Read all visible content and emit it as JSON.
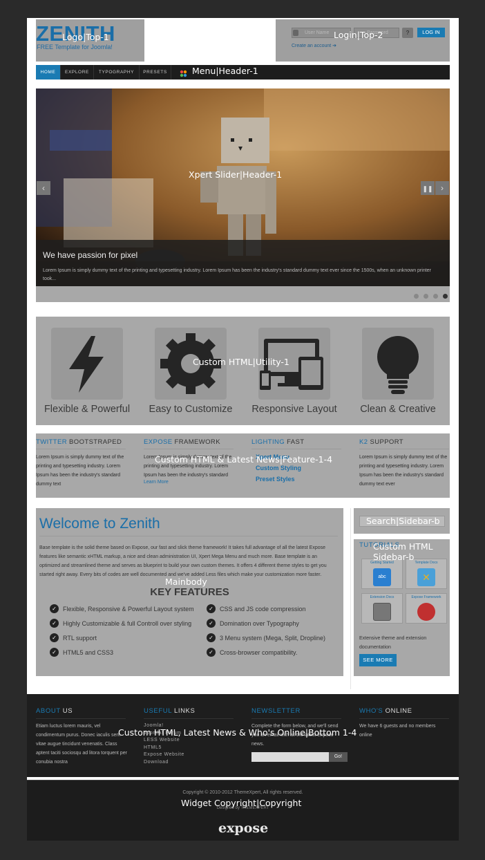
{
  "colors": {
    "accent": "#1a7bb3",
    "background": "#2a2a2a",
    "placeholder": "#a8a8a8"
  },
  "header": {
    "logo_title": "ZENITH",
    "logo_subtitle": "FREE Template for Joomla!",
    "logo_annotation": "Logo|Top-1",
    "login_annotation": "Login|Top-2",
    "username_placeholder": "User Name",
    "password_placeholder": "Password",
    "login_button": "LOG IN",
    "create_account": "Create an account"
  },
  "menu": {
    "annotation": "Menu|Header-1",
    "items": [
      "HOME",
      "EXPLORE",
      "TYPOGRAPHY",
      "PRESETS"
    ]
  },
  "slider": {
    "annotation": "Xpert Slider|Header-1",
    "caption_title": "We have passion for pixel",
    "caption_text": "Lorem Ipsum is simply dummy text of the printing and typesetting industry. Lorem Ipsum has been the industry's standard dummy text ever since the 1500s, when an unknown printer took...",
    "slide_count": 4,
    "active_slide": 4
  },
  "utility": {
    "annotation": "Custom HTML|Utility-1",
    "items": [
      {
        "label": "Flexible & Powerful",
        "icon": "lightning-icon"
      },
      {
        "label": "Easy to Customize",
        "icon": "gear-icon"
      },
      {
        "label": "Responsive Layout",
        "icon": "devices-icon"
      },
      {
        "label": "Clean & Creative",
        "icon": "lightbulb-icon"
      }
    ]
  },
  "feature": {
    "annotation": "Custom HTML & Latest News|Feature-1-4",
    "cols": [
      {
        "hl": "TWITTER",
        "rest": " BOOTSTRAPED",
        "text": "Lorem Ipsum is simply dummy text of the printing and typesetting industry. Lorem Ipsum has been the industry's standard dummy text"
      },
      {
        "hl": "EXPOSE",
        "rest": " FRAMEWORK",
        "text": "Lorem Ipsum is simply dummy text of the printing and typesetting industry. Lorem Ipsum has been the industry's standard",
        "link": "Learn More"
      },
      {
        "hl": "LIGHTING",
        "rest": " FAST",
        "links": [
          "Xpert Menu",
          "Custom Styling",
          "Preset Styles"
        ]
      },
      {
        "hl": "K2",
        "rest": " SUPPORT",
        "text": "Lorem Ipsum is simply dummy text of the printing and typesetting industry. Lorem Ipsum has been the industry's standard dummy text ever"
      }
    ]
  },
  "main": {
    "annotation": "Mainbody",
    "title": "Welcome to Zenith",
    "text": "Base template is the solid theme based on Expose, our fast and slick theme framework! It takes full advantage of all the latest Expose features like semantic xHTML markup, a nice and clean administration UI, Xpert Mega Menu and much more. Base template is an optimized and streamlined theme and serves as blueprint to build your own custom themes. It offers 4 different theme styles to get you started right away. Every bits of codes are well documented and we've added Less files which make your customization more faster.",
    "features_title": "KEY FEATURES",
    "features_left": [
      "Flexible, Responsive & Powerful Layout system",
      "Highly Customizable & full Controll over styling",
      "RTL support",
      "HTML5 and CSS3"
    ],
    "features_right": [
      "CSS and JS code compression",
      "Domination over Typography",
      "3 Menu system (Mega, Split, Dropline)",
      "Cross-browser compatibility."
    ]
  },
  "sidebar": {
    "search_annotation": "Search|Sidebar-b",
    "custom_annotation_1": "Custom HTML",
    "custom_annotation_2": "Sidebar-b",
    "tutorials_title": "TUTORIALS",
    "tiles": [
      {
        "label": "Getting Started",
        "icon": "abc-icon"
      },
      {
        "label": "Template Docs",
        "icon": "tools-icon"
      },
      {
        "label": "Extension Docs",
        "icon": "switch-icon"
      },
      {
        "label": "Expose Framework",
        "icon": "expose-icon"
      }
    ],
    "text": "Extensive theme and extension documentation",
    "see_more": "SEE MORE"
  },
  "bottom": {
    "annotation": "Custom HTML, Latest News & Who's Online|Bottom 1-4",
    "about_hl": "ABOUT",
    "about_rest": " US",
    "about_text": "Etiam luctus lorem mauris, vel condimentum purus. Donec iaculis sem vitae augue tincidunt venenatis. Class aptent taciti sociosqu ad litora torquent per conubia nostra",
    "useful_hl": "USEFUL",
    "useful_rest": " LINKS",
    "useful_links": [
      "Joomla!",
      "Joomla! Forum",
      "LESS Website",
      "HTML5",
      "Expose Website",
      "Download"
    ],
    "newsletter_hl": "NEWSLETTER",
    "newsletter_rest": "",
    "newsletter_text": "Complete the form below, and we'll send you an email with all the latest Expose news.",
    "newsletter_button": "Go!",
    "online_hl": "WHO'S",
    "online_rest": " ONLINE",
    "online_text": "We have 6 guests and no members online"
  },
  "copyright": {
    "annotation": "Widget Copyright|Copyright",
    "text": "Copyright © 2010-2012 ThemeXpert, All rights reserved.",
    "designed": "Designed by THEMEXPERT",
    "logo": "expose"
  }
}
